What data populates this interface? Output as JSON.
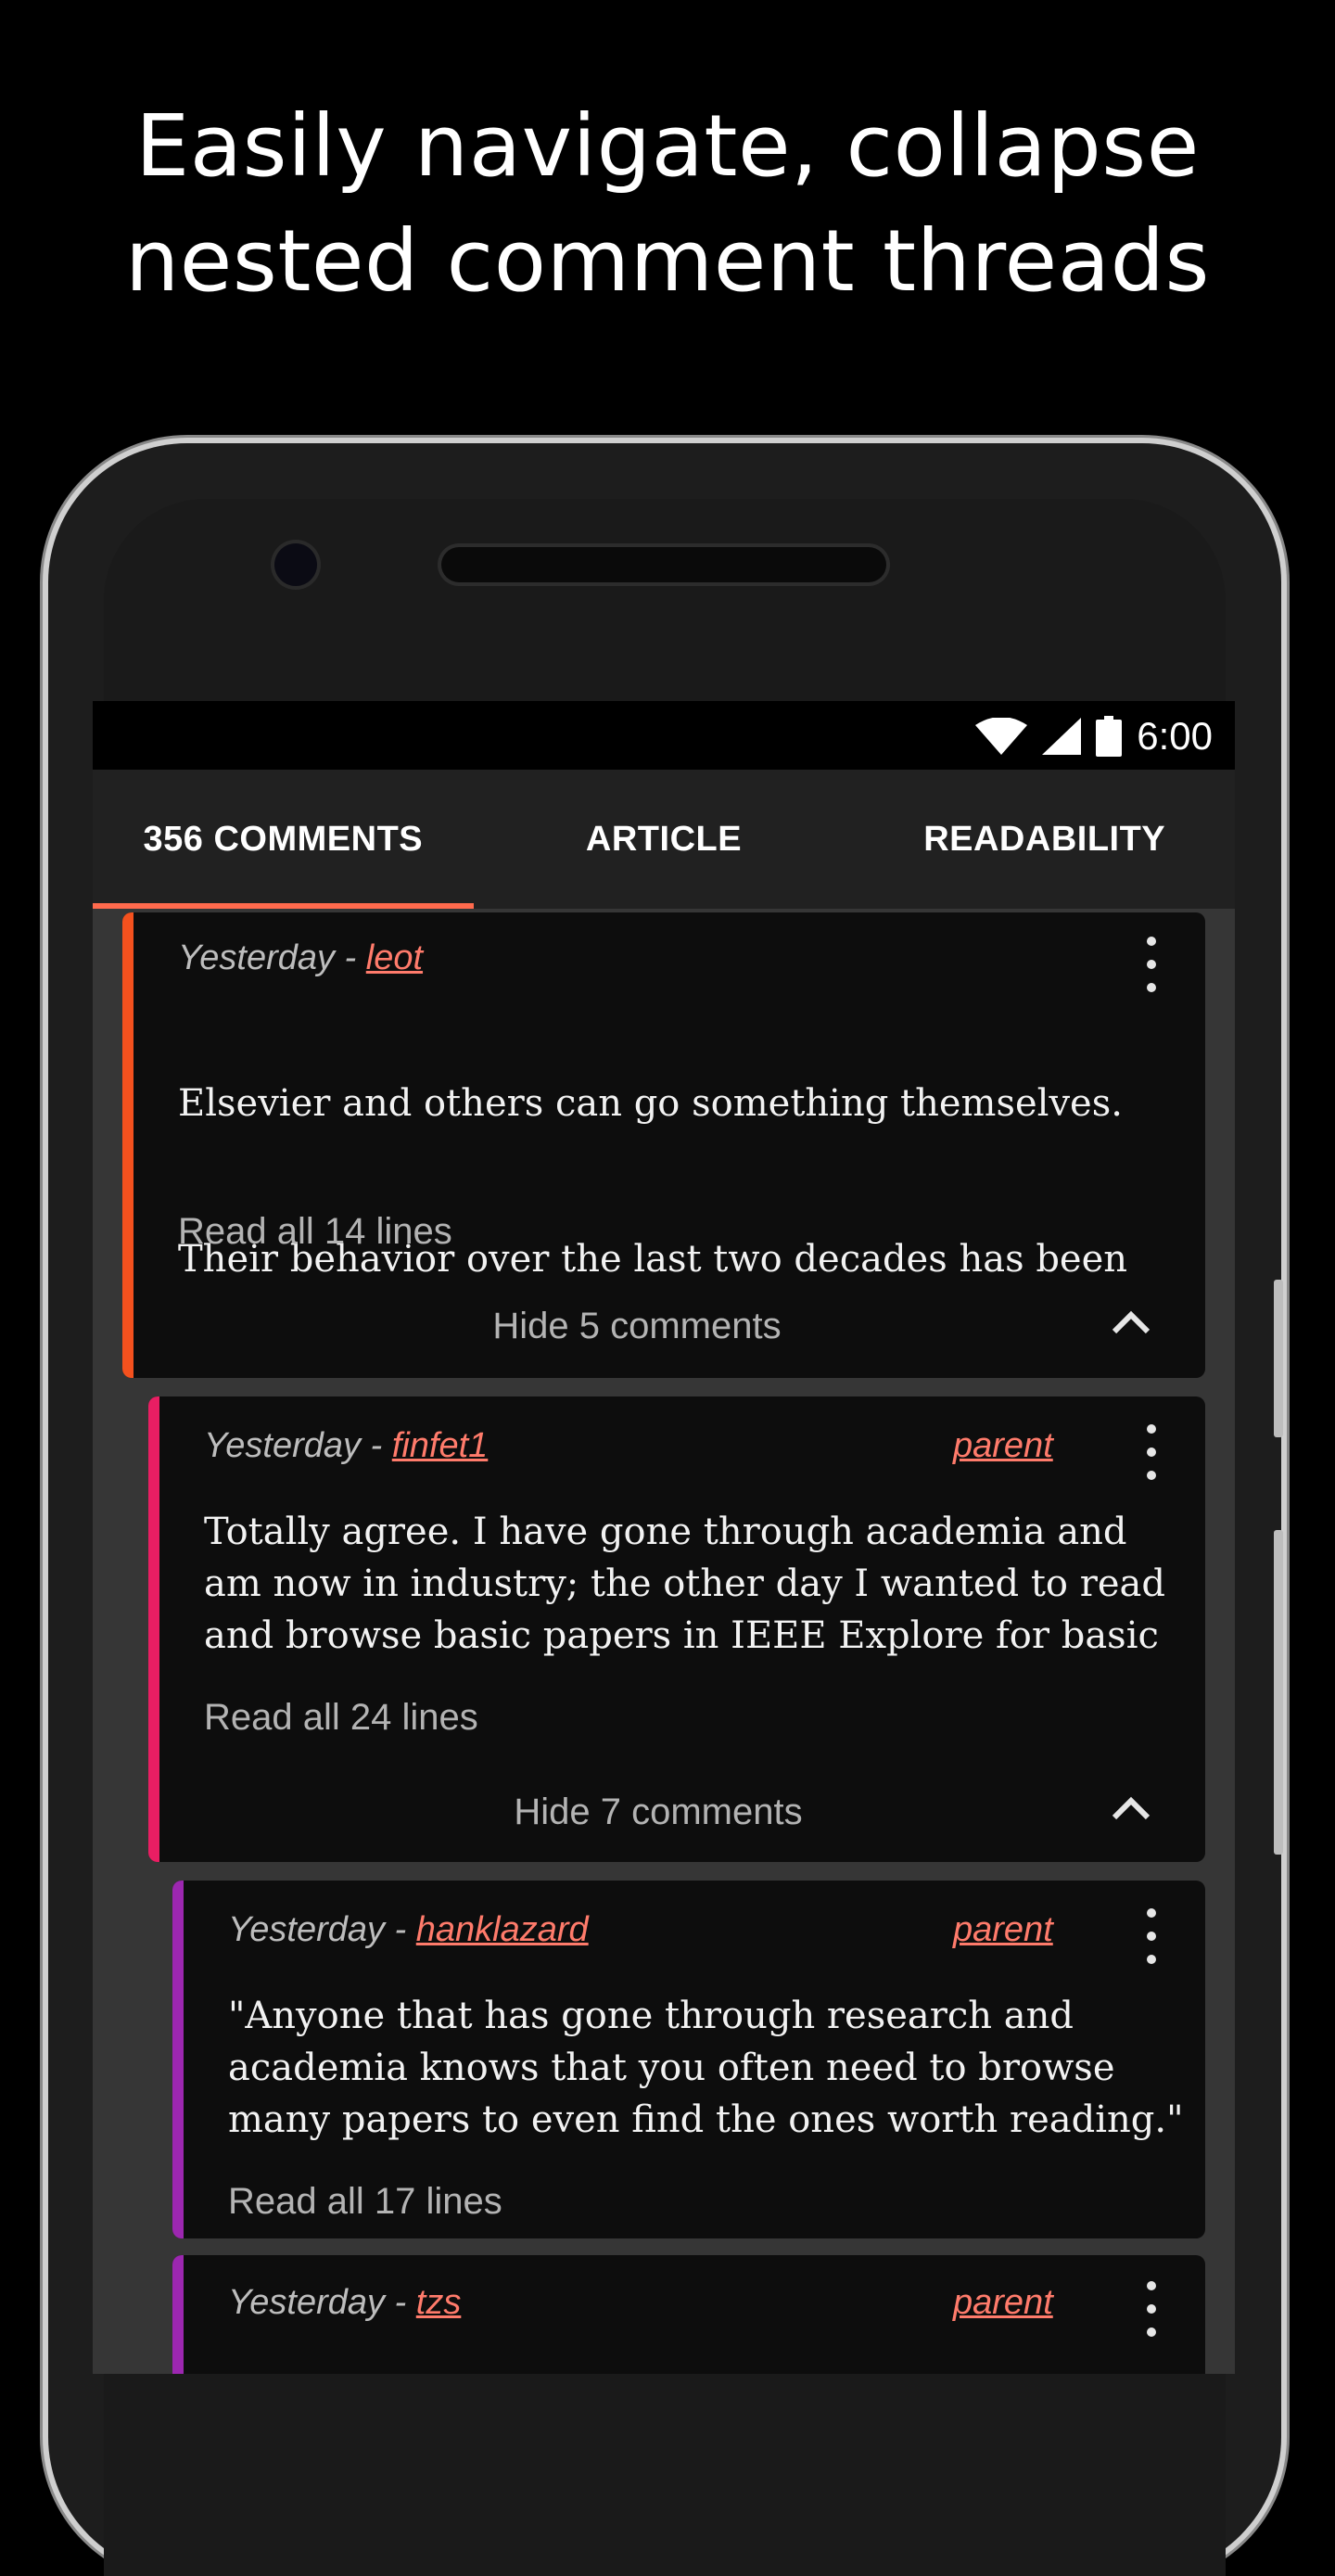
{
  "headline": {
    "line1": "Easily navigate, collapse",
    "line2": "nested comment threads"
  },
  "status_bar": {
    "icons": [
      "wifi-icon",
      "signal-icon",
      "battery-icon"
    ],
    "time": "6:00"
  },
  "tabs": [
    {
      "label": "356 COMMENTS",
      "active": true
    },
    {
      "label": "ARTICLE",
      "active": false
    },
    {
      "label": "READABILITY",
      "active": false
    }
  ],
  "accent_color": "#ff6a4d",
  "comments": [
    {
      "date": "Yesterday - ",
      "user": "leot",
      "parent": "",
      "body_line1": "Elsevier and others can go something themselves.",
      "body_line2": "Their behavior over the last two decades has been",
      "read_more": "Read all 14 lines",
      "hide_label": "Hide 5 comments",
      "bar_color": "#f4511e"
    },
    {
      "date": "Yesterday - ",
      "user": "finfet1",
      "parent": "parent",
      "body": "Totally agree. I have gone through academia and\nam now in industry; the other day I wanted to read\nand browse basic papers in IEEE Explore for basic",
      "read_more": "Read all 24 lines",
      "hide_label": "Hide 7 comments",
      "bar_color": "#e91e63"
    },
    {
      "date": "Yesterday - ",
      "user": "hanklazard",
      "parent": "parent",
      "body": "\"Anyone that has gone through research and\nacademia knows that you often need to browse\nmany papers to even find the ones worth reading.\"",
      "read_more": "Read all 17 lines",
      "bar_color": "#9c27b0"
    },
    {
      "date": "Yesterday - ",
      "user": "tzs",
      "parent": "parent",
      "bar_color": "#9c27b0"
    }
  ]
}
